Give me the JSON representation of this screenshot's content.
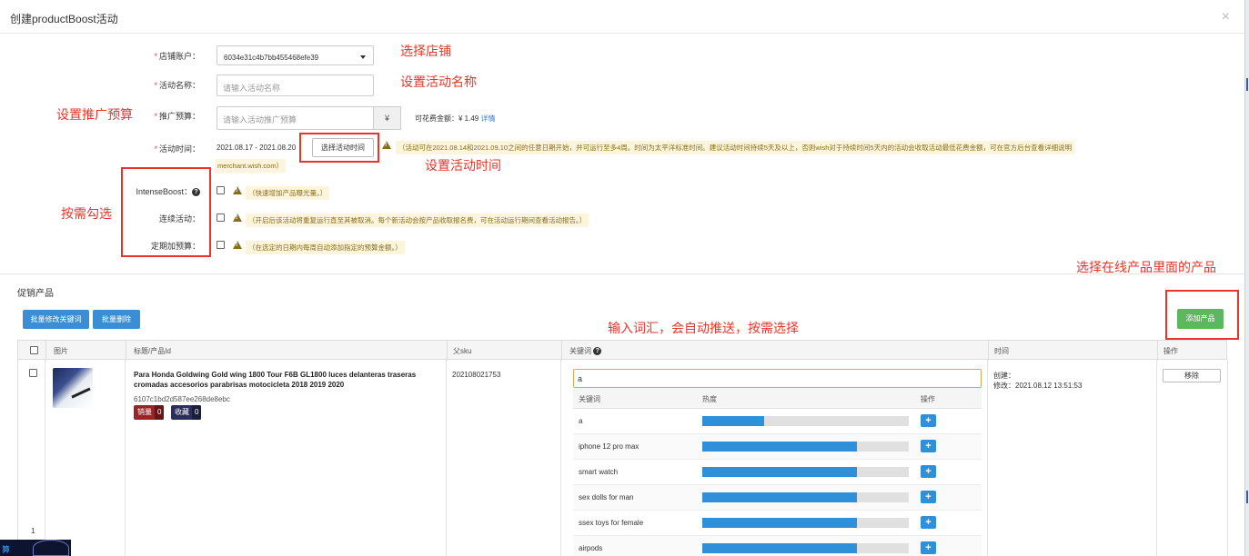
{
  "dialog": {
    "title": "创建productBoost活动",
    "close": "×"
  },
  "form": {
    "store_account": {
      "label": "店铺账户：",
      "value": "6034e31c4b7bb455468efe39"
    },
    "campaign_name": {
      "label": "活动名称：",
      "placeholder": "请输入活动名称"
    },
    "budget": {
      "label": "推广预算：",
      "placeholder": "请输入活动推广预算",
      "currency": "¥",
      "available_label": "可花费金额：¥ 1.49",
      "details_link": "详情"
    },
    "campaign_time": {
      "label": "活动时间：",
      "value": "2021.08.17 - 2021.08.20",
      "button": "选择活动时间",
      "note_line1": "（活动可在2021.08.14和2021.09.10之间的任意日期开始，并可运行至多4周。时间为太平洋标准时间。建议活动时间持续5天及以上，否则wish对于持续时间5天内的活动会收取活动最低花费金额，可在官方后台查看详细说明",
      "note_line2": "merchant.wish.com）"
    },
    "intense_boost": {
      "label": "IntenseBoost：",
      "help": "?",
      "note": "（快速增加产品曝光量。）"
    },
    "continuous": {
      "label": "连续活动：",
      "note": "（开启后该活动将重复运行直至其被取消。每个新活动会按产品收取报名费，可在活动运行期间查看活动报告。）"
    },
    "auto_budget": {
      "label": "定期加预算：",
      "note": "（在选定的日期内每周自动添加指定的预算金额。）"
    }
  },
  "annotations": {
    "select_store": "选择店铺",
    "set_name": "设置活动名称",
    "set_budget": "设置推广预算",
    "set_time": "设置活动时间",
    "check_as_needed": "按需勾选",
    "select_product": "选择在线产品里面的产品",
    "keyword_hint": "输入词汇，会自动推送，按需选择"
  },
  "promo": {
    "section_title": "促销产品",
    "batch_edit_keywords": "批量修改关键词",
    "batch_delete": "批量删除",
    "add_product": "添加产品"
  },
  "table": {
    "headers": {
      "image": "图片",
      "title": "标题/产品Id",
      "parent_sku": "父sku",
      "keywords": "关键词",
      "time": "时间",
      "action": "操作"
    },
    "row": {
      "title": "Para Honda Goldwing Gold wing 1800 Tour F6B GL1800 luces delanteras traseras cromadas accesorios parabrisas motocicleta 2018 2019 2020",
      "product_id": "6107c1bd2d587ee268de8ebc",
      "sales_label": "销量",
      "sales_count": "0",
      "fav_label": "收藏",
      "fav_count": "0",
      "parent_sku": "202108021753",
      "created": "创建：",
      "modified": "修改：2021.08.12 13:51:53",
      "remove": "移除",
      "index": "1",
      "keyword_input": "a"
    }
  },
  "keyword_panel": {
    "headers": {
      "keyword": "关键词",
      "heat": "热度",
      "action": "操作"
    },
    "rows": [
      {
        "keyword": "a",
        "heat": 0.3
      },
      {
        "keyword": "iphone 12 pro max",
        "heat": 0.75
      },
      {
        "keyword": "smart watch",
        "heat": 0.75
      },
      {
        "keyword": "sex dolls for man",
        "heat": 0.75
      },
      {
        "keyword": "ssex toys for female",
        "heat": 0.75
      },
      {
        "keyword": "airpods",
        "heat": 0.75
      }
    ],
    "add_symbol": "+"
  },
  "taskbar": {
    "label": "算"
  },
  "colors": {
    "annotation_red": "#e8352a",
    "primary_blue": "#3b8ed3",
    "success_green": "#5cb85c",
    "heat_bar": "#2f8fd8",
    "warning_text": "#8a6d1b"
  }
}
